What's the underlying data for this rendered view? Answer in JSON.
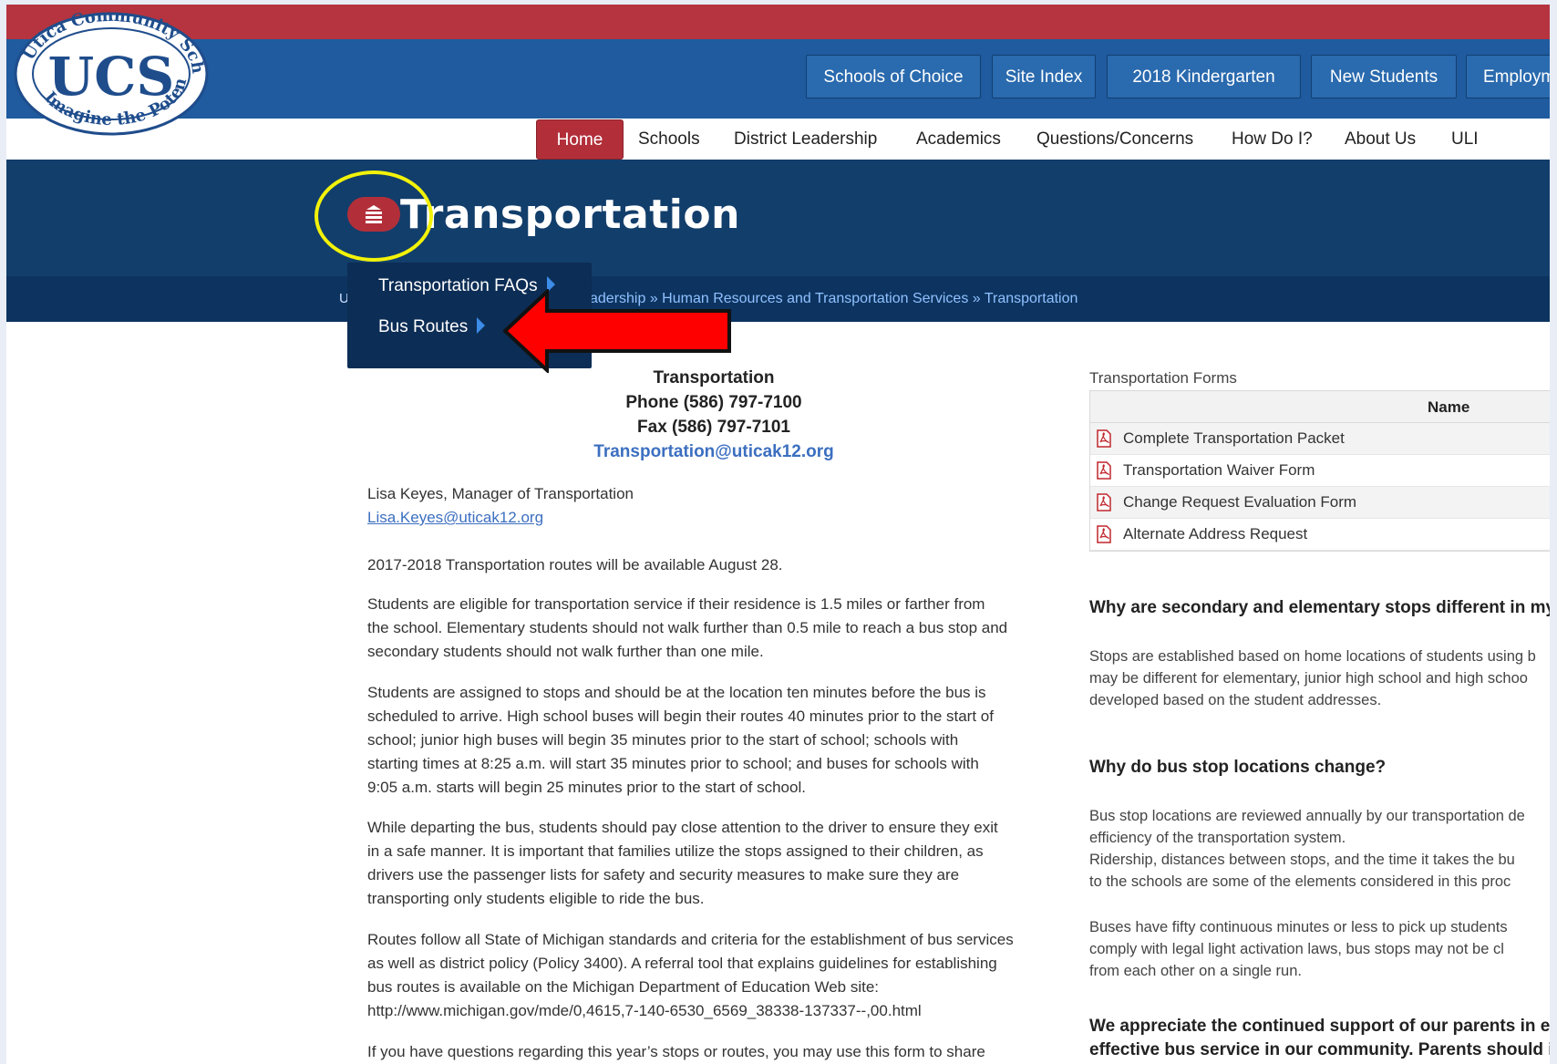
{
  "header": {
    "logo_text_top": "Utica Community Schools",
    "logo_monogram": "UCS",
    "logo_text_bottom": "Imagine the Potential",
    "utility_nav": [
      "Schools of Choice",
      "Site Index",
      "2018 Kindergarten",
      "New Students",
      "Employm"
    ],
    "main_nav": [
      "Home",
      "Schools",
      "District Leadership",
      "Academics",
      "Questions/Concerns",
      "How Do I?",
      "About Us",
      "ULI"
    ],
    "active_nav": "Home"
  },
  "hero": {
    "title": "Transportation",
    "menu_icon": "hamburger-icon"
  },
  "breadcrumb": {
    "start": "U",
    "trail": "adership » Human Resources and Transportation Services » Transportation"
  },
  "dropdown": {
    "items": [
      "Transportation FAQs",
      "Bus Routes"
    ]
  },
  "contact": {
    "title": "Transportation",
    "phone": "Phone (586) 797-7100",
    "fax": "Fax (586) 797-7101",
    "email": "Transportation@uticak12.org"
  },
  "manager": {
    "line": "Lisa Keyes, Manager of Transportation",
    "email": "Lisa.Keyes@uticak12.org "
  },
  "body": {
    "p1": "2017-2018 Transportation routes will be available August  28.",
    "p2": [
      "Students are eligible for transportation service if their residence is 1.5 miles or farther from",
      "the school. Elementary students should not walk further than 0.5 mile to reach a bus stop and",
      "secondary students should not walk further than one mile."
    ],
    "p3": [
      "Students are assigned to stops and should be at the location ten minutes before the bus is",
      "scheduled to arrive. High school buses will begin their routes 40 minutes prior to the start of",
      "school;  junior high buses will begin 35 minutes prior to the start of school; schools with",
      "starting times at 8:25 a.m. will start 35 minutes prior to school; and buses for schools with",
      "9:05 a.m. starts will begin 25 minutes prior to the start of school."
    ],
    "p4": [
      "While departing the bus, students should pay close attention to the driver to ensure they exit",
      "in a safe manner. It is important that families utilize the stops assigned to their children, as",
      "drivers use the passenger lists for safety and security measures to make sure they are",
      "transporting only students eligible to ride the bus."
    ],
    "p5": [
      "Routes follow all State of Michigan standards and criteria for the establishment of bus services",
      "as well as district policy (Policy 3400). A referral tool that explains guidelines for establishing",
      "bus routes is available on the Michigan Department of Education Web site:",
      "http://www.michigan.gov/mde/0,4615,7-140-6530_6569_38338-137337--,00.html"
    ],
    "p6": "If you have questions regarding this year’s stops or routes, you may use this form to share"
  },
  "forms": {
    "label": "Transportation Forms",
    "column": "Name",
    "rows": [
      "Complete Transportation Packet",
      "Transportation Waiver Form",
      "Change Request Evaluation Form",
      "Alternate Address Request"
    ]
  },
  "faq": {
    "q1": "Why are secondary and elementary stops different in my",
    "a1": [
      "Stops are established based on home locations of students using b",
      "may be different for elementary, junior high school and high schoo",
      "developed based on the student addresses."
    ],
    "q2": "Why do bus stop locations change?",
    "a2": [
      "Bus stop locations are reviewed annually by our transportation de",
      "efficiency of the transportation system.",
      "Ridership, distances between stops, and the time it takes the bu",
      "to the schools are some of the elements considered in this proc"
    ],
    "a3": [
      "Buses have fifty continuous minutes or less to pick up students",
      "comply with legal light activation laws, bus stops may not be cl",
      "from each other on a single run."
    ],
    "q3": [
      "We appreciate the continued support of our parents in e",
      "effective bus service in our community. Parents should i"
    ]
  },
  "colors": {
    "top_stripe": "#b5343f",
    "utility_band": "#1f5b9e",
    "hero_band": "#123e6b",
    "active_nav": "#b22f3a",
    "highlight_ring": "#f2f20a",
    "annotation_arrow": "#ff0000"
  }
}
